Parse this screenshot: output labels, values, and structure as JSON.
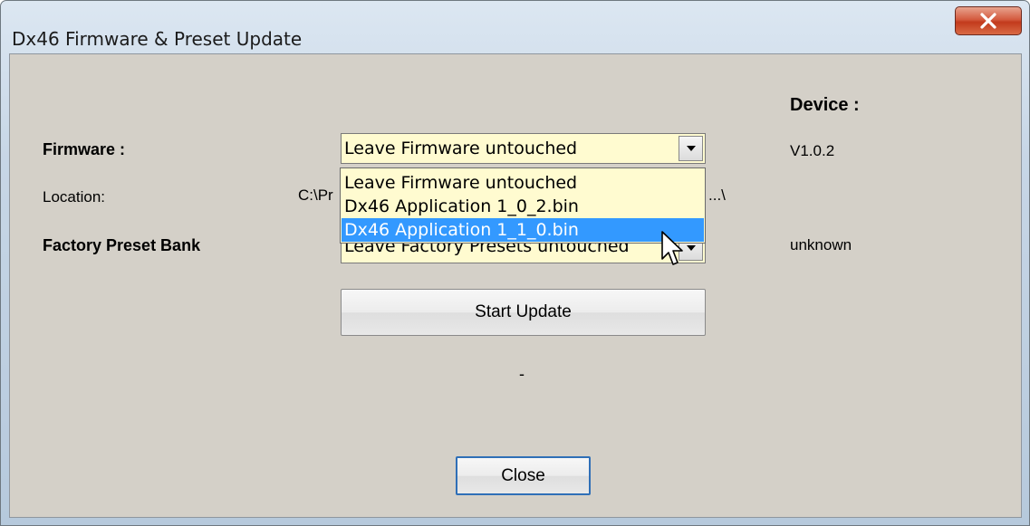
{
  "window": {
    "title": "Dx46 Firmware & Preset Update"
  },
  "device_header": "Device :",
  "firmware": {
    "label": "Firmware :",
    "selected": "Leave Firmware untouched",
    "device_version": "V1.0.2"
  },
  "location": {
    "label": "Location:",
    "path_start": "C:\\Pr",
    "path_end": "...\\"
  },
  "preset_bank": {
    "label": "Factory Preset Bank",
    "selected": "Leave Factory Presets untouched",
    "device_value": "unknown"
  },
  "dropdown": {
    "options": [
      "Leave Firmware untouched",
      "Dx46 Application 1_0_2.bin",
      "Dx46 Application 1_1_0.bin"
    ],
    "highlighted_index": 2
  },
  "start_update_label": "Start Update",
  "status_text": "-",
  "close_label": "Close",
  "colors": {
    "combo_bg": "#fffbd0",
    "highlight": "#3399ff",
    "dialog_bg": "#d4d0c8",
    "close_button": "#c23a1c"
  },
  "icons": {
    "close": "close-x-icon",
    "dropdown_arrow": "chevron-down-icon",
    "cursor": "mouse-pointer-icon"
  }
}
